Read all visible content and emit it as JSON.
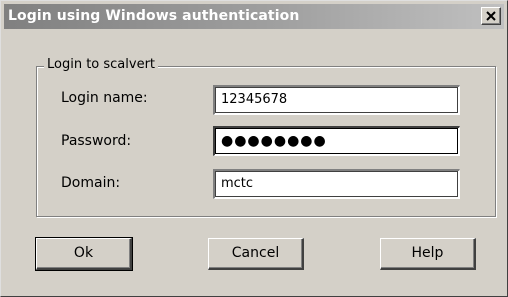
{
  "window": {
    "title": "Login using Windows authentication",
    "close_glyph": "×"
  },
  "group": {
    "legend": "Login to scalvert"
  },
  "fields": {
    "login_name": {
      "label": "Login name:",
      "value": "12345678"
    },
    "password": {
      "label": "Password:",
      "value": "●●●●●●●●"
    },
    "domain": {
      "label": "Domain:",
      "value": "mctc"
    }
  },
  "buttons": {
    "ok": "Ok",
    "cancel": "Cancel",
    "help": "Help"
  },
  "colors": {
    "face": "#d4d0c8",
    "title_gradient_start": "#808080",
    "title_gradient_end": "#c0c0c0",
    "input_bg": "#ffffff"
  },
  "icons": {
    "close": "close-icon"
  }
}
